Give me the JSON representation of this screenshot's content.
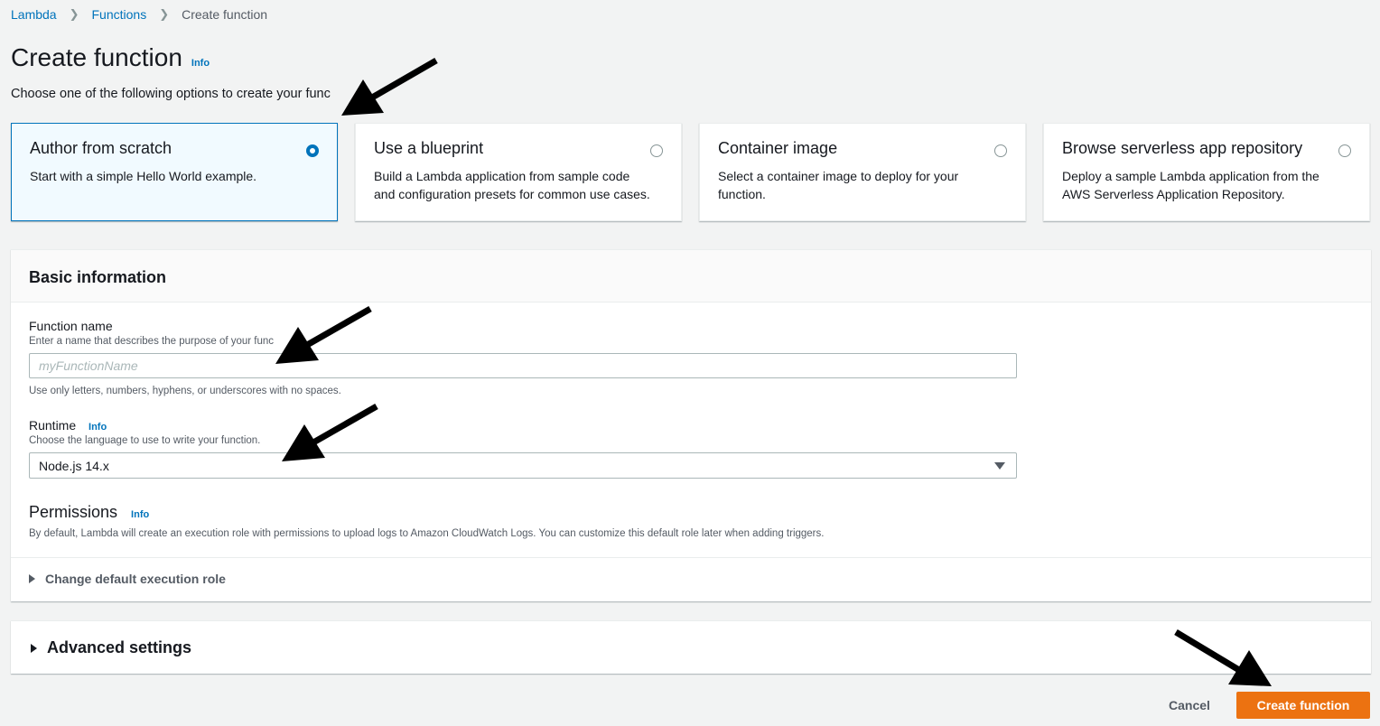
{
  "breadcrumb": {
    "items": [
      "Lambda",
      "Functions"
    ],
    "current": "Create function"
  },
  "page": {
    "title": "Create function",
    "info": "Info",
    "subtitle": "Choose one of the following options to create your func"
  },
  "options": [
    {
      "title": "Author from scratch",
      "desc": "Start with a simple Hello World example.",
      "selected": true
    },
    {
      "title": "Use a blueprint",
      "desc": "Build a Lambda application from sample code and configuration presets for common use cases.",
      "selected": false
    },
    {
      "title": "Container image",
      "desc": "Select a container image to deploy for your function.",
      "selected": false
    },
    {
      "title": "Browse serverless app repository",
      "desc": "Deploy a sample Lambda application from the AWS Serverless Application Repository.",
      "selected": false
    }
  ],
  "basic": {
    "header": "Basic information",
    "function_name": {
      "label": "Function name",
      "desc": "Enter a name that describes the purpose of your func",
      "placeholder": "myFunctionName",
      "hint": "Use only letters, numbers, hyphens, or underscores with no spaces."
    },
    "runtime": {
      "label": "Runtime",
      "info": "Info",
      "desc": "Choose the language to use to write your function.",
      "value": "Node.js 14.x"
    },
    "permissions": {
      "label": "Permissions",
      "info": "Info",
      "desc": "By default, Lambda will create an execution role with permissions to upload logs to Amazon CloudWatch Logs. You can customize this default role later when adding triggers.",
      "expander": "Change default execution role"
    }
  },
  "advanced": {
    "label": "Advanced settings"
  },
  "actions": {
    "cancel": "Cancel",
    "create": "Create function"
  },
  "colors": {
    "accent": "#0073bb",
    "primary_button": "#ec7211",
    "background": "#f2f3f3"
  }
}
